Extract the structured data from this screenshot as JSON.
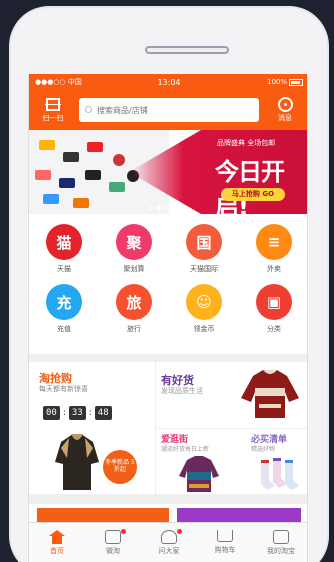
{
  "status_bar": {
    "carrier": "●●●○○ 中国",
    "time": "13:04",
    "battery": "100%"
  },
  "header": {
    "scan_label": "扫一扫",
    "search_placeholder": "搜索商品/店铺",
    "message_label": "消息"
  },
  "banner": {
    "small_text": "品牌盛典 全场包邮",
    "big_text": "今日开启!",
    "pill_text": "马上抢购 GO"
  },
  "categories": [
    {
      "label": "天猫",
      "color": "#e3232c",
      "glyph": "猫"
    },
    {
      "label": "聚划算",
      "color": "#ef3a6a",
      "glyph": "聚"
    },
    {
      "label": "天猫国际",
      "color": "#f35b3b",
      "glyph": "国"
    },
    {
      "label": "外卖",
      "color": "#ff8a13",
      "glyph": "≡"
    },
    {
      "label": "充值",
      "color": "#24a6f0",
      "glyph": "充"
    },
    {
      "label": "旅行",
      "color": "#f5512e",
      "glyph": "旅"
    },
    {
      "label": "领金币",
      "color": "#ffb21c",
      "glyph": "☺"
    },
    {
      "label": "分类",
      "color": "#ef3f33",
      "glyph": "▣"
    }
  ],
  "promo": {
    "block_a_title": "淘抢购",
    "block_a_sub": "每天都有新惊喜",
    "countdown": [
      "00",
      "33",
      "48"
    ],
    "block_b_title": "有好货",
    "block_b_sub": "发现品质生活",
    "block_c_title": "爱逛街",
    "block_c_sub": "潮流好货每日上新",
    "block_d_title": "必买清单",
    "block_d_sub": "精选好物",
    "badge_text": "冬季新品 5折起"
  },
  "tabbar": [
    {
      "label": "首页",
      "active": true
    },
    {
      "label": "微淘",
      "active": false
    },
    {
      "label": "问大家",
      "active": false
    },
    {
      "label": "购物车",
      "active": false
    },
    {
      "label": "我的淘宝",
      "active": false
    }
  ]
}
